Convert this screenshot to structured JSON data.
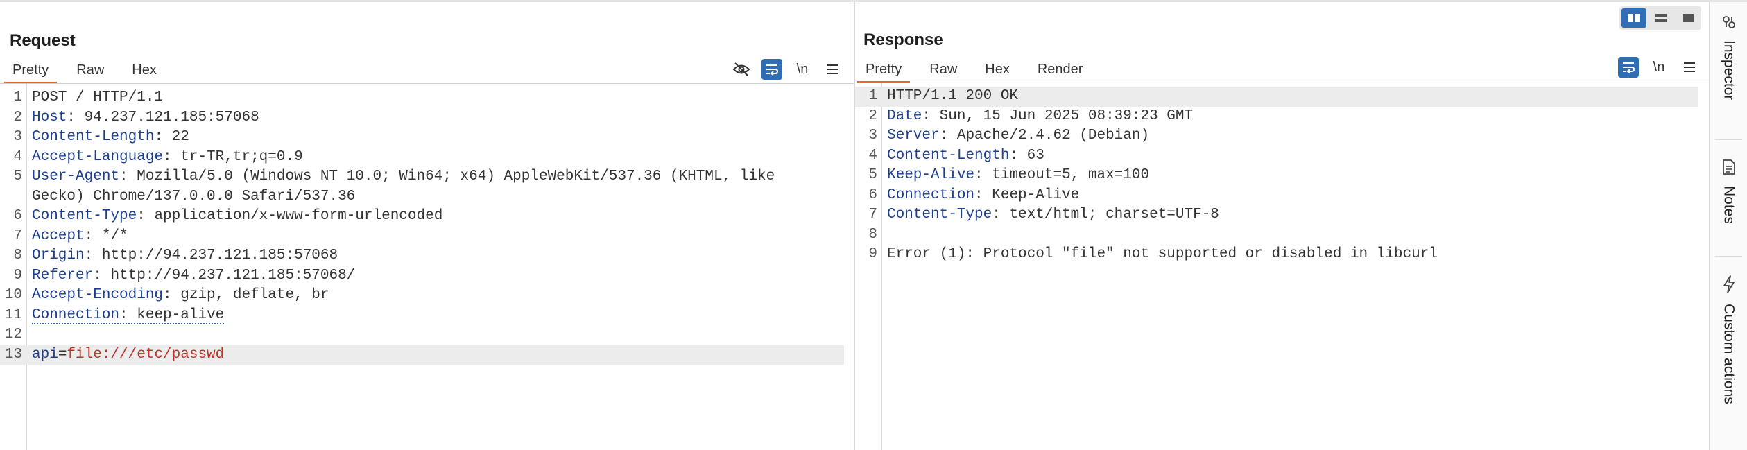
{
  "request": {
    "title": "Request",
    "tabs": [
      "Pretty",
      "Raw",
      "Hex"
    ],
    "active_tab": "Pretty",
    "tools": [
      "eye-off-icon",
      "wrap-icon",
      "\\n",
      "menu-icon"
    ],
    "lines": [
      {
        "n": "1",
        "key": "",
        "sep": "",
        "val": "POST / HTTP/1.1"
      },
      {
        "n": "2",
        "key": "Host",
        "sep": ": ",
        "val": "94.237.121.185:57068"
      },
      {
        "n": "3",
        "key": "Content-Length",
        "sep": ": ",
        "val": "22"
      },
      {
        "n": "4",
        "key": "Accept-Language",
        "sep": ": ",
        "val": "tr-TR,tr;q=0.9"
      },
      {
        "n": "5",
        "key": "User-Agent",
        "sep": ": ",
        "val": "Mozilla/5.0 (Windows NT 10.0; Win64; x64) AppleWebKit/537.36 (KHTML, like Gecko) Chrome/137.0.0.0 Safari/537.36"
      },
      {
        "n": "6",
        "key": "Content-Type",
        "sep": ": ",
        "val": "application/x-www-form-urlencoded"
      },
      {
        "n": "7",
        "key": "Accept",
        "sep": ": ",
        "val": "*/*"
      },
      {
        "n": "8",
        "key": "Origin",
        "sep": ": ",
        "val": "http://94.237.121.185:57068"
      },
      {
        "n": "9",
        "key": "Referer",
        "sep": ": ",
        "val": "http://94.237.121.185:57068/"
      },
      {
        "n": "10",
        "key": "Accept-Encoding",
        "sep": ": ",
        "val": "gzip, deflate, br"
      },
      {
        "n": "11",
        "key": "Connection",
        "sep": ": ",
        "val": "keep-alive"
      },
      {
        "n": "12",
        "key": "",
        "sep": "",
        "val": ""
      },
      {
        "n": "13",
        "key": "api",
        "sep": "=",
        "val": "file:///etc/passwd"
      }
    ]
  },
  "response": {
    "title": "Response",
    "tabs": [
      "Pretty",
      "Raw",
      "Hex",
      "Render"
    ],
    "active_tab": "Pretty",
    "tools": [
      "wrap-icon",
      "\\n",
      "menu-icon"
    ],
    "lines": [
      {
        "n": "1",
        "key": "",
        "sep": "",
        "val": "HTTP/1.1 200 OK"
      },
      {
        "n": "2",
        "key": "Date",
        "sep": ": ",
        "val": "Sun, 15 Jun 2025 08:39:23 GMT"
      },
      {
        "n": "3",
        "key": "Server",
        "sep": ": ",
        "val": "Apache/2.4.62 (Debian)"
      },
      {
        "n": "4",
        "key": "Content-Length",
        "sep": ": ",
        "val": "63"
      },
      {
        "n": "5",
        "key": "Keep-Alive",
        "sep": ": ",
        "val": "timeout=5, max=100"
      },
      {
        "n": "6",
        "key": "Connection",
        "sep": ": ",
        "val": "Keep-Alive"
      },
      {
        "n": "7",
        "key": "Content-Type",
        "sep": ": ",
        "val": "text/html; charset=UTF-8"
      },
      {
        "n": "8",
        "key": "",
        "sep": "",
        "val": ""
      },
      {
        "n": "9",
        "key": "",
        "sep": "",
        "val": "Error (1): Protocol \"file\" not supported or disabled in libcurl"
      }
    ]
  },
  "sidebar": {
    "items": [
      {
        "label": "Inspector",
        "icon": "inspector-icon"
      },
      {
        "label": "Notes",
        "icon": "notes-icon"
      },
      {
        "label": "Custom actions",
        "icon": "lightning-icon"
      }
    ]
  },
  "layout_toggle": [
    "split-vertical-icon",
    "split-horizontal-icon",
    "single-pane-icon"
  ],
  "colors": {
    "accent": "#e8692c",
    "active_blue": "#2f6eb5",
    "header_key": "#1d3f8f",
    "param_value": "#c0332b"
  }
}
